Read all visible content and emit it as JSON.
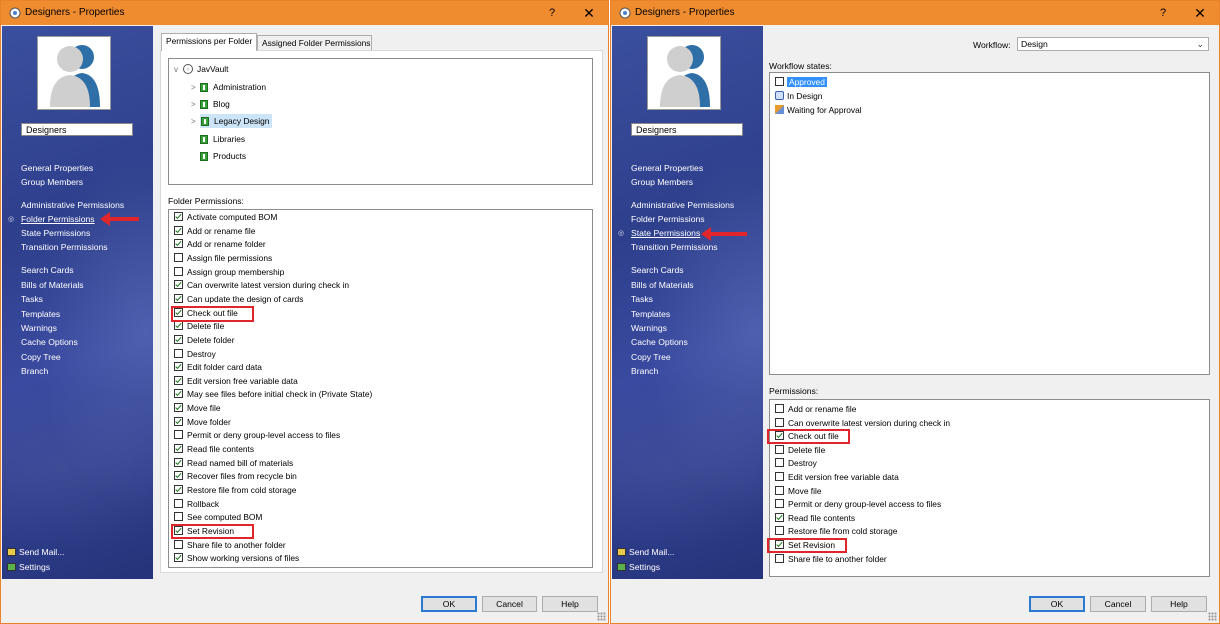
{
  "window_left": {
    "title": "Designers - Properties",
    "help": "?",
    "close": "✕",
    "group_name": "Designers",
    "nav": [
      {
        "label": "General Properties"
      },
      {
        "label": "Group Members"
      },
      {
        "label": "Administrative Permissions"
      },
      {
        "label": "Folder Permissions"
      },
      {
        "label": "State Permissions"
      },
      {
        "label": "Transition Permissions"
      },
      {
        "label": "Search Cards"
      },
      {
        "label": "Bills of Materials"
      },
      {
        "label": "Tasks"
      },
      {
        "label": "Templates"
      },
      {
        "label": "Warnings"
      },
      {
        "label": "Cache Options"
      },
      {
        "label": "Copy Tree"
      },
      {
        "label": "Branch"
      }
    ],
    "bottom_links": {
      "send_mail": "Send Mail...",
      "settings": "Settings"
    },
    "tabs": [
      "Permissions per Folder",
      "Assigned Folder Permissions"
    ],
    "tree": {
      "root": "JavVault",
      "children": [
        "Administration",
        "Blog",
        "Legacy Design",
        "Libraries",
        "Products"
      ],
      "selected": "Legacy Design"
    },
    "permissions_label": "Folder Permissions:",
    "permissions": [
      {
        "label": "Activate computed BOM",
        "checked": true
      },
      {
        "label": "Add or rename file",
        "checked": true
      },
      {
        "label": "Add or rename folder",
        "checked": true
      },
      {
        "label": "Assign file permissions",
        "checked": false
      },
      {
        "label": "Assign group membership",
        "checked": false
      },
      {
        "label": "Can overwrite latest version during check in",
        "checked": true
      },
      {
        "label": "Can update the design of cards",
        "checked": true
      },
      {
        "label": "Check out file",
        "checked": true
      },
      {
        "label": "Delete file",
        "checked": true
      },
      {
        "label": "Delete folder",
        "checked": true
      },
      {
        "label": "Destroy",
        "checked": false
      },
      {
        "label": "Edit folder card data",
        "checked": true
      },
      {
        "label": "Edit version free variable data",
        "checked": true
      },
      {
        "label": "May see files before initial check in (Private State)",
        "checked": true
      },
      {
        "label": "Move file",
        "checked": true
      },
      {
        "label": "Move folder",
        "checked": true
      },
      {
        "label": "Permit or deny group-level access to files",
        "checked": false
      },
      {
        "label": "Read file contents",
        "checked": true
      },
      {
        "label": "Read named bill of materials",
        "checked": true
      },
      {
        "label": "Recover files from recycle bin",
        "checked": true
      },
      {
        "label": "Restore file from cold storage",
        "checked": true
      },
      {
        "label": "Rollback",
        "checked": false
      },
      {
        "label": "See computed BOM",
        "checked": false
      },
      {
        "label": "Set Revision",
        "checked": true
      },
      {
        "label": "Share file to another folder",
        "checked": false
      },
      {
        "label": "Show working versions of files",
        "checked": true
      }
    ],
    "buttons": {
      "ok": "OK",
      "cancel": "Cancel",
      "help": "Help"
    }
  },
  "window_right": {
    "title": "Designers - Properties",
    "help": "?",
    "close": "✕",
    "group_name": "Designers",
    "nav": [
      {
        "label": "General Properties"
      },
      {
        "label": "Group Members"
      },
      {
        "label": "Administrative Permissions"
      },
      {
        "label": "Folder Permissions"
      },
      {
        "label": "State Permissions"
      },
      {
        "label": "Transition Permissions"
      },
      {
        "label": "Search Cards"
      },
      {
        "label": "Bills of Materials"
      },
      {
        "label": "Tasks"
      },
      {
        "label": "Templates"
      },
      {
        "label": "Warnings"
      },
      {
        "label": "Cache Options"
      },
      {
        "label": "Copy Tree"
      },
      {
        "label": "Branch"
      }
    ],
    "bottom_links": {
      "send_mail": "Send Mail...",
      "settings": "Settings"
    },
    "workflow_label": "Workflow:",
    "workflow_value": "Design",
    "states_label": "Workflow states:",
    "states": [
      {
        "label": "Approved",
        "selected": true
      },
      {
        "label": "In Design",
        "selected": false
      },
      {
        "label": "Waiting for Approval",
        "selected": false
      }
    ],
    "permissions_label": "Permissions:",
    "permissions": [
      {
        "label": "Add or rename file",
        "checked": false
      },
      {
        "label": "Can overwrite latest version during check in",
        "checked": false
      },
      {
        "label": "Check out file",
        "checked": true
      },
      {
        "label": "Delete file",
        "checked": false
      },
      {
        "label": "Destroy",
        "checked": false
      },
      {
        "label": "Edit version free variable data",
        "checked": false
      },
      {
        "label": "Move file",
        "checked": false
      },
      {
        "label": "Permit or deny group-level access to files",
        "checked": false
      },
      {
        "label": "Read file contents",
        "checked": true
      },
      {
        "label": "Restore file from cold storage",
        "checked": false
      },
      {
        "label": "Set Revision",
        "checked": true
      },
      {
        "label": "Share file to another folder",
        "checked": false
      }
    ],
    "buttons": {
      "ok": "OK",
      "cancel": "Cancel",
      "help": "Help"
    }
  },
  "colors": {
    "titlebar": "#f08c30",
    "highlight": "#e0262b",
    "sidebar": "#2e3f8c"
  }
}
